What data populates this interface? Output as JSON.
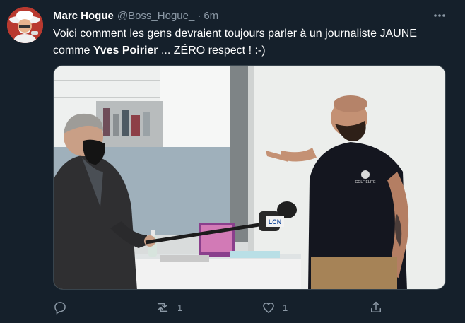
{
  "author": {
    "name": "Marc Hogue",
    "handle": "@Boss_Hogue_",
    "separator": "·",
    "time": "6m"
  },
  "more_label": "⋯",
  "text": {
    "line1": "Voici comment les gens devraient toujours parler à un journaliste JAUNE",
    "line2_prefix": "comme ",
    "line2_bold": "Yves Poirier",
    "line2_suffix": " ... ZÉRO respect !   :-)"
  },
  "media": {
    "mic_flag": "LCN",
    "shirt_logo": "GOLF ELITE"
  },
  "actions": {
    "reply_count": "",
    "retweet_count": "1",
    "like_count": "1"
  },
  "colors": {
    "background": "#15202b",
    "secondary_text": "#8b98a5",
    "border": "#38444d"
  },
  "icons": [
    "more-icon",
    "reply-icon",
    "retweet-icon",
    "like-icon",
    "share-icon"
  ]
}
